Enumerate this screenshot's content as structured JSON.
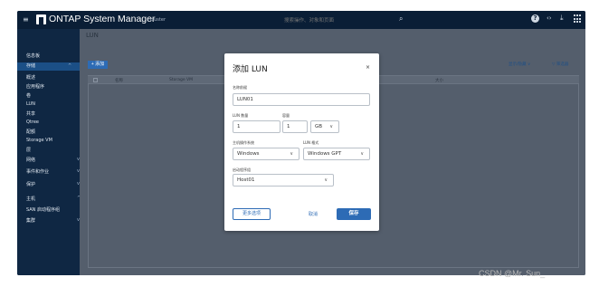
{
  "topbar": {
    "app_title": "ONTAP System Manager",
    "cluster_name": "cluster",
    "search_placeholder": "搜索操作、对象和页面",
    "help_icon": "?"
  },
  "sidebar": {
    "items": [
      {
        "label": "信息板",
        "chevron": ""
      },
      {
        "label": "存储",
        "chevron": "^"
      },
      {
        "label": "概述",
        "chevron": ""
      },
      {
        "label": "应用程序",
        "chevron": ""
      },
      {
        "label": "卷",
        "chevron": ""
      },
      {
        "label": "LUN",
        "chevron": ""
      },
      {
        "label": "共享",
        "chevron": ""
      },
      {
        "label": "Qtree",
        "chevron": ""
      },
      {
        "label": "配额",
        "chevron": ""
      },
      {
        "label": "Storage VM",
        "chevron": ""
      },
      {
        "label": "层",
        "chevron": ""
      },
      {
        "label": "网络",
        "chevron": "v"
      },
      {
        "label": "事件和作业",
        "chevron": "v"
      },
      {
        "label": "保护",
        "chevron": "v"
      },
      {
        "label": "主机",
        "chevron": "^"
      },
      {
        "label": "SAN 启动程序组",
        "chevron": ""
      },
      {
        "label": "集群",
        "chevron": "v"
      }
    ]
  },
  "main": {
    "page_title": "LUN",
    "add_button": "+ 添加",
    "show_hide": "显示/隐藏 ∨",
    "filter": "▽ 筛选器",
    "columns": [
      "名称",
      "Storage VM",
      "大小"
    ]
  },
  "modal": {
    "title": "添加 LUN",
    "close": "×",
    "name_label": "名称前缀",
    "name_value": "LUN01",
    "lun_count_label": "LUN 数量",
    "lun_count_value": "1",
    "capacity_label": "容量",
    "capacity_value": "1",
    "unit_value": "GB",
    "host_os_label": "主机操作系统",
    "host_os_value": "Windows",
    "lun_format_label": "LUN 格式",
    "lun_format_value": "Windows GPT",
    "initiator_group_label": "启动程序组",
    "initiator_group_value": "Host01",
    "more_options": "更多选项",
    "cancel": "取消",
    "save": "保存"
  },
  "watermark": "CSDN @Mr. Sun_",
  "colors": {
    "topbar_bg": "#0a1e36",
    "sidebar_bg": "#0f2743",
    "active_item": "#1b4f86",
    "primary_button": "#2d6bb5",
    "overlay": "#545e6c"
  }
}
